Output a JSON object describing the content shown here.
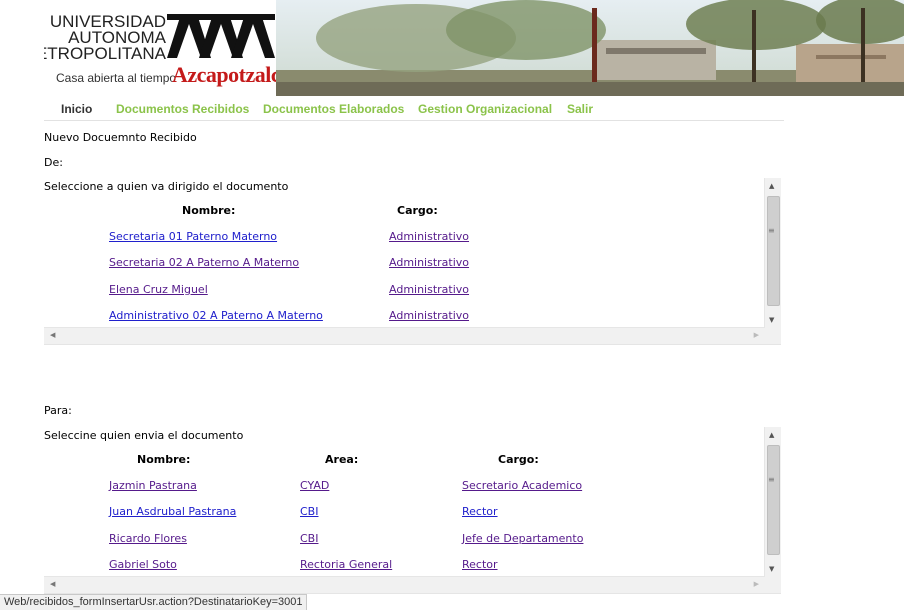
{
  "header": {
    "logo_lines": [
      "UNIVERSIDAD",
      "AUTONOMA",
      "METROPOLITANA"
    ],
    "tagline": "Casa abierta al tiempo",
    "campus": "Azcapotzalco"
  },
  "nav": {
    "items": [
      {
        "label": "Inicio"
      },
      {
        "label": "Documentos Recibidos"
      },
      {
        "label": "Documentos Elaborados"
      },
      {
        "label": "Gestion Organizacional"
      },
      {
        "label": "Salir"
      }
    ]
  },
  "page": {
    "title": "Nuevo Docuemnto Recibido",
    "de_label": "De:",
    "para_label": "Para:"
  },
  "de_section": {
    "instruction": "Seleccione a quien va dirigido el documento",
    "headers": {
      "nombre": "Nombre:",
      "cargo": "Cargo:"
    },
    "rows": [
      {
        "nombre": "Secretaria 01 Paterno Materno",
        "cargo": "Administrativo"
      },
      {
        "nombre": "Secretaria 02 A Paterno A Materno",
        "cargo": "Administrativo"
      },
      {
        "nombre": "Elena Cruz Miguel",
        "cargo": "Administrativo"
      },
      {
        "nombre": "Administrativo 02 A Paterno A Materno",
        "cargo": "Administrativo"
      }
    ]
  },
  "para_section": {
    "instruction": "Seleccine quien envia el documento",
    "headers": {
      "nombre": "Nombre:",
      "area": "Area:",
      "cargo": "Cargo:"
    },
    "rows": [
      {
        "nombre": "Jazmin Pastrana",
        "area": "CYAD",
        "cargo": "Secretario Academico"
      },
      {
        "nombre": "Juan Asdrubal Pastrana",
        "area": "CBI",
        "cargo": "Rector"
      },
      {
        "nombre": "Ricardo Flores",
        "area": "CBI",
        "cargo": "Jefe de Departamento"
      },
      {
        "nombre": "Gabriel Soto",
        "area": "Rectoria General",
        "cargo": "Rector"
      }
    ]
  },
  "status_bar": {
    "url": "Web/recibidos_formInsertarUsr.action?DestinatarioKey=3001"
  },
  "colors": {
    "nav_link": "#8bc34a",
    "link": "#2020cc",
    "visited_link": "#551a8b",
    "uam_red": "#c41a1a"
  }
}
